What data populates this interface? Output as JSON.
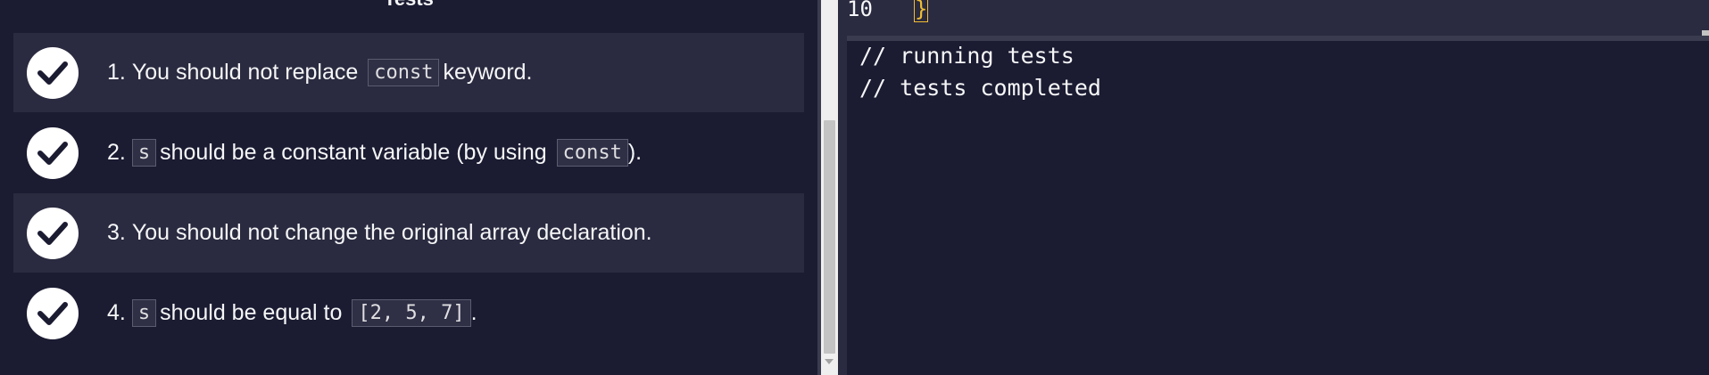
{
  "tests_panel": {
    "heading": "Tests",
    "tests": [
      {
        "number": "1.",
        "parts": {
          "a": "You should not replace",
          "code1": "const",
          "b": "keyword."
        },
        "status": "passed"
      },
      {
        "number": "2.",
        "parts": {
          "code0": "s",
          "a": "should be a constant variable (by using",
          "code1": "const",
          "b": ")."
        },
        "status": "passed"
      },
      {
        "number": "3.",
        "parts": {
          "a": "You should not change the original array declaration."
        },
        "status": "passed"
      },
      {
        "number": "4.",
        "parts": {
          "code0": "s",
          "a": "should be equal to",
          "code1": "[2, 5, 7]",
          "b": "."
        },
        "status": "passed"
      }
    ]
  },
  "editor": {
    "line_number": "10",
    "line_text": "}"
  },
  "console": {
    "lines": [
      "// running tests",
      "// tests completed"
    ]
  },
  "colors": {
    "background": "#1b1b32",
    "shaded_row": "#2a2a40",
    "text": "#f5f6f7",
    "brace_highlight": "#f1be32"
  },
  "icons": {
    "test_status": "check-circle-icon"
  }
}
